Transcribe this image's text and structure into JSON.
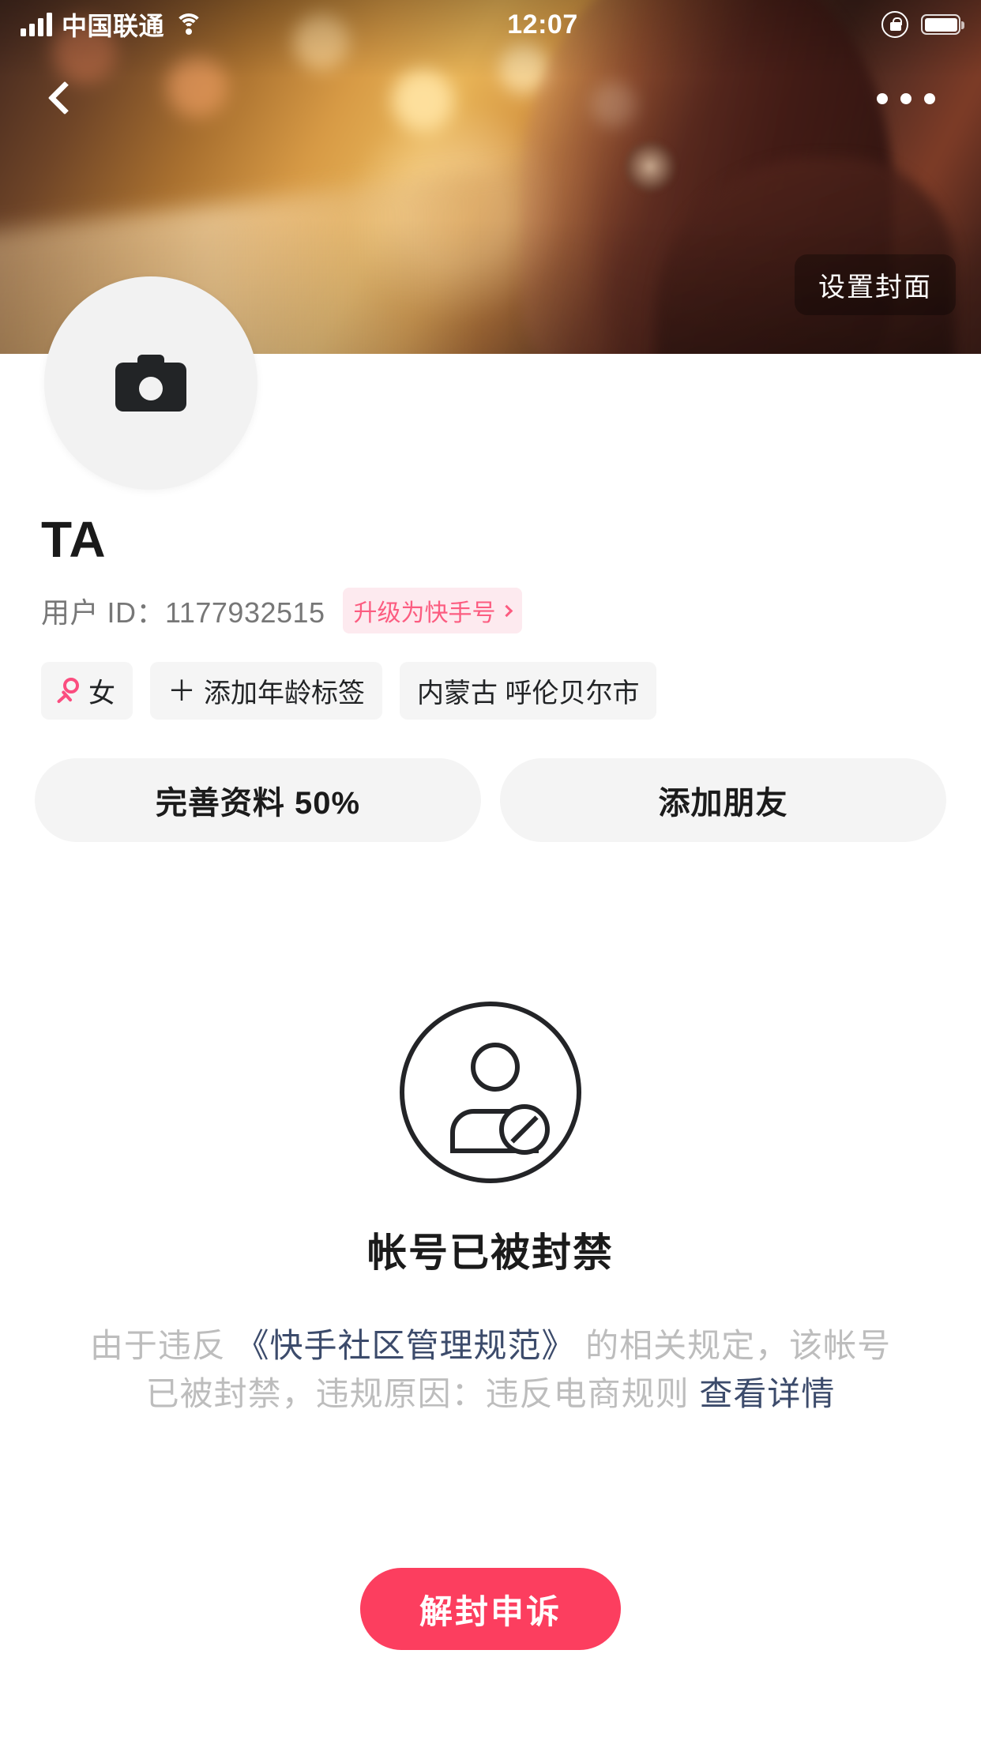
{
  "status_bar": {
    "carrier": "中国联通",
    "time": "12:07",
    "signal_icon": "signal-bars-icon",
    "wifi_icon": "wifi-icon",
    "rotation_lock_icon": "rotation-lock-icon",
    "battery_icon": "battery-icon"
  },
  "nav": {
    "back_icon": "back-chevron-icon",
    "more_icon": "more-dots-icon"
  },
  "cover": {
    "set_cover_label": "设置封面"
  },
  "avatar": {
    "camera_icon": "camera-icon"
  },
  "profile": {
    "username": "TA",
    "user_id_label": "用户 ID：1177932515",
    "upgrade_badge": "升级为快手号",
    "upgrade_chevron_icon": "chevron-right-icon",
    "tags": [
      {
        "icon": "female-gender-icon",
        "label": "女"
      },
      {
        "icon": "plus-icon",
        "label": "添加年龄标签"
      },
      {
        "icon": "",
        "label": "内蒙古 呼伦贝尔市"
      }
    ]
  },
  "actions": {
    "complete_profile": "完善资料 50%",
    "add_friend": "添加朋友"
  },
  "banned": {
    "icon": "user-banned-icon",
    "title": "帐号已被封禁",
    "desc_part1": "由于违反 ",
    "desc_link1": "《快手社区管理规范》",
    "desc_part2": " 的相关规定，该帐号已被封禁，违规原因：违反电商规则 ",
    "desc_link2": "查看详情",
    "appeal_button": "解封申诉"
  },
  "colors": {
    "accent_pink": "#fc3e5f",
    "badge_pink_bg": "#fdeaef",
    "badge_pink_text": "#fc5c80",
    "link_blue": "#3c4b6b",
    "muted_text": "#bdbdbd",
    "chip_bg": "#f5f5f5",
    "button_bg": "#f4f4f4"
  }
}
